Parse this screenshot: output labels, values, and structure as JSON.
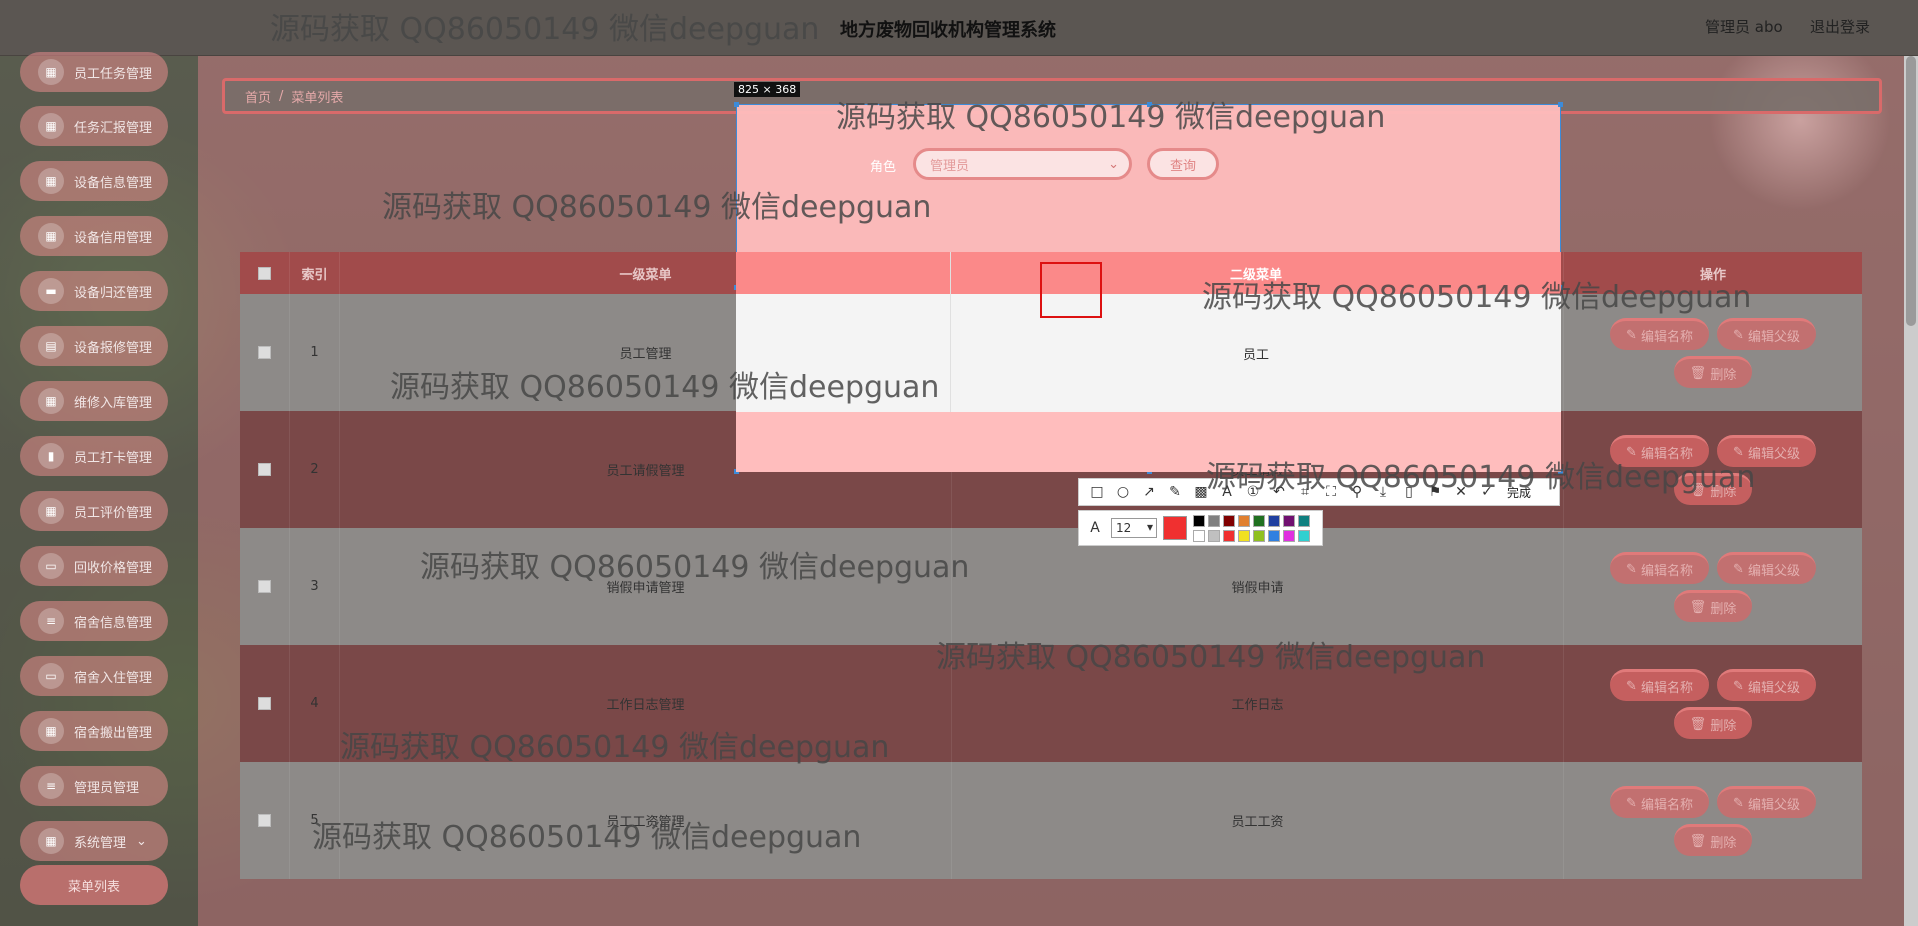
{
  "header": {
    "system_title": "地方废物回收机构管理系统",
    "user": "管理员 abo",
    "logout": "退出登录"
  },
  "sidebar": {
    "items": [
      {
        "label": "员工任务管理",
        "icon": "grid-icon"
      },
      {
        "label": "任务汇报管理",
        "icon": "grid-icon"
      },
      {
        "label": "设备信息管理",
        "icon": "grid-icon"
      },
      {
        "label": "设备信用管理",
        "icon": "grid-icon"
      },
      {
        "label": "设备归还管理",
        "icon": "chat-icon"
      },
      {
        "label": "设备报修管理",
        "icon": "chart-icon"
      },
      {
        "label": "维修入库管理",
        "icon": "grid-icon"
      },
      {
        "label": "员工打卡管理",
        "icon": "bar-icon"
      },
      {
        "label": "员工评价管理",
        "icon": "grid-icon"
      },
      {
        "label": "回收价格管理",
        "icon": "monitor-icon"
      },
      {
        "label": "宿舍信息管理",
        "icon": "list-icon"
      },
      {
        "label": "宿舍入住管理",
        "icon": "monitor-icon"
      },
      {
        "label": "宿舍搬出管理",
        "icon": "grid-icon"
      },
      {
        "label": "管理员管理",
        "icon": "list-icon"
      },
      {
        "label": "系统管理",
        "icon": "grid-icon"
      }
    ],
    "sub_item": "菜单列表"
  },
  "breadcrumb": {
    "home": "首页",
    "sep": "/",
    "current": "菜单列表"
  },
  "search": {
    "role_label": "角色",
    "role_value": "管理员",
    "query_button": "查询"
  },
  "table": {
    "headers": [
      "索引",
      "一级菜单",
      "二级菜单",
      "操作"
    ],
    "rows": [
      {
        "index": "1",
        "menu1": "员工管理",
        "menu2": "员工"
      },
      {
        "index": "2",
        "menu1": "员工请假管理",
        "menu2": "员工请假"
      },
      {
        "index": "3",
        "menu1": "销假申请管理",
        "menu2": "销假申请"
      },
      {
        "index": "4",
        "menu1": "工作日志管理",
        "menu2": "工作日志"
      },
      {
        "index": "5",
        "menu1": "员工工资管理",
        "menu2": "员工工资"
      }
    ],
    "actions": {
      "edit_name": "编辑名称",
      "edit_parent": "编辑父级",
      "delete": "删除"
    }
  },
  "capture": {
    "size_label": "825 × 368",
    "font_size": "12",
    "done": "完成"
  },
  "watermark": "源码获取 QQ86050149 微信deepguan",
  "colors": {
    "accent": "#e07a7a",
    "capture_border": "#3c8bd9"
  }
}
